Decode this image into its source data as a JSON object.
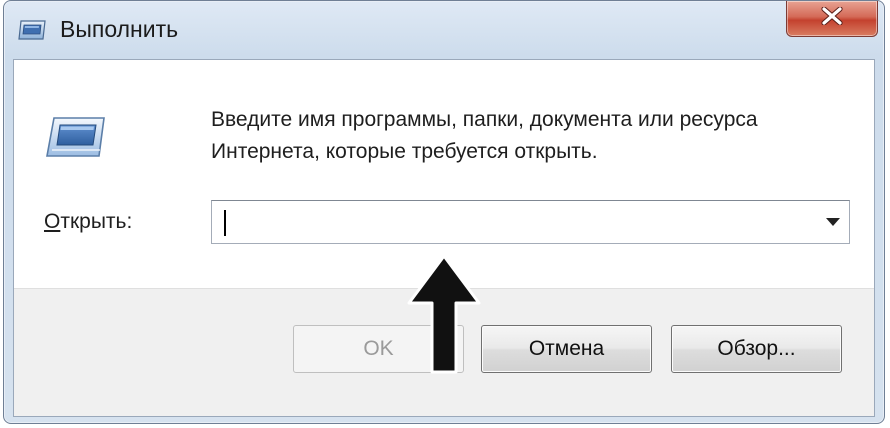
{
  "window": {
    "title": "Выполнить",
    "title_icon": "run-dialog-icon",
    "close_icon": "close-icon",
    "close_color": "#c4412e"
  },
  "dialog": {
    "icon": "run-program-icon",
    "description_line1": "Введите имя программы, папки, документа или ресурса",
    "description_line2": "Интернета, которые требуется открыть.",
    "open_label_accel": "О",
    "open_label_rest": "ткрыть:",
    "open_value": "",
    "dropdown_icon": "chevron-down-icon"
  },
  "buttons": {
    "ok_label": "OK",
    "cancel_label": "Отмена",
    "browse_label": "Обзор..."
  },
  "annotation": {
    "icon": "up-arrow-icon",
    "color": "#111111"
  }
}
